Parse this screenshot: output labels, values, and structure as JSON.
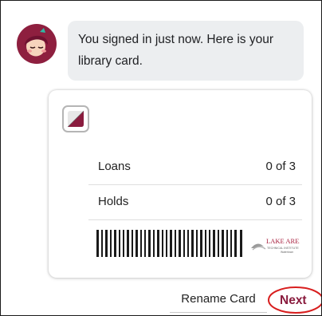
{
  "message": {
    "text": "You signed in just now. Here is your library card."
  },
  "card": {
    "loans_label": "Loans",
    "loans_value": "0 of 3",
    "holds_label": "Holds",
    "holds_value": "0 of 3",
    "barcode_icon": "barcode-icon",
    "library_logo": "lake-area-technical-institute-logo",
    "library_logo_text": "LAKE AREA TECHNICAL INSTITUTE"
  },
  "actions": {
    "rename_label": "Rename Card",
    "next_label": "Next"
  },
  "colors": {
    "accent": "#8a1c3e",
    "bubble_bg": "#eceef0",
    "annotation_red": "#d81e1e",
    "avatar_bg": "#8e1f3f"
  }
}
